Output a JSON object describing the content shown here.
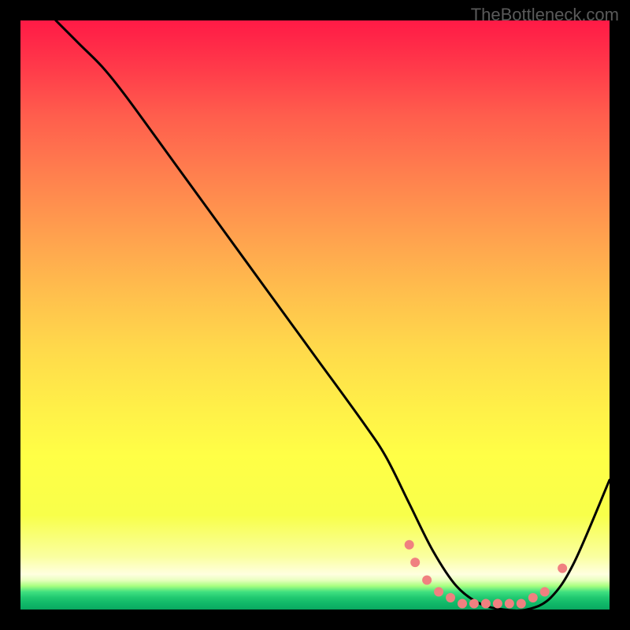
{
  "watermark": "TheBottleneck.com",
  "chart_data": {
    "type": "line",
    "title": "",
    "xlabel": "",
    "ylabel": "",
    "xlim": [
      0,
      100
    ],
    "ylim": [
      0,
      100
    ],
    "grid": false,
    "legend": false,
    "series": [
      {
        "name": "bottleneck-curve",
        "color": "#000000",
        "x": [
          6,
          10,
          14,
          18,
          26,
          34,
          42,
          50,
          58,
          62,
          66,
          70,
          74,
          78,
          82,
          86,
          90,
          94,
          100
        ],
        "y": [
          100,
          96,
          92,
          87,
          76,
          65,
          54,
          43,
          32,
          26,
          18,
          10,
          4,
          1,
          0,
          0,
          2,
          8,
          22
        ]
      }
    ],
    "markers": [
      {
        "x": 66,
        "y": 11,
        "color": "#f08080"
      },
      {
        "x": 67,
        "y": 8,
        "color": "#f08080"
      },
      {
        "x": 69,
        "y": 5,
        "color": "#f08080"
      },
      {
        "x": 71,
        "y": 3,
        "color": "#f08080"
      },
      {
        "x": 73,
        "y": 2,
        "color": "#f08080"
      },
      {
        "x": 75,
        "y": 1,
        "color": "#f08080"
      },
      {
        "x": 77,
        "y": 1,
        "color": "#f08080"
      },
      {
        "x": 79,
        "y": 1,
        "color": "#f08080"
      },
      {
        "x": 81,
        "y": 1,
        "color": "#f08080"
      },
      {
        "x": 83,
        "y": 1,
        "color": "#f08080"
      },
      {
        "x": 85,
        "y": 1,
        "color": "#f08080"
      },
      {
        "x": 87,
        "y": 2,
        "color": "#f08080"
      },
      {
        "x": 89,
        "y": 3,
        "color": "#f08080"
      },
      {
        "x": 92,
        "y": 7,
        "color": "#f08080"
      }
    ],
    "gradient_colors": {
      "top": "#ff1a46",
      "mid": "#ffff46",
      "bottom": "#0aa860"
    }
  }
}
